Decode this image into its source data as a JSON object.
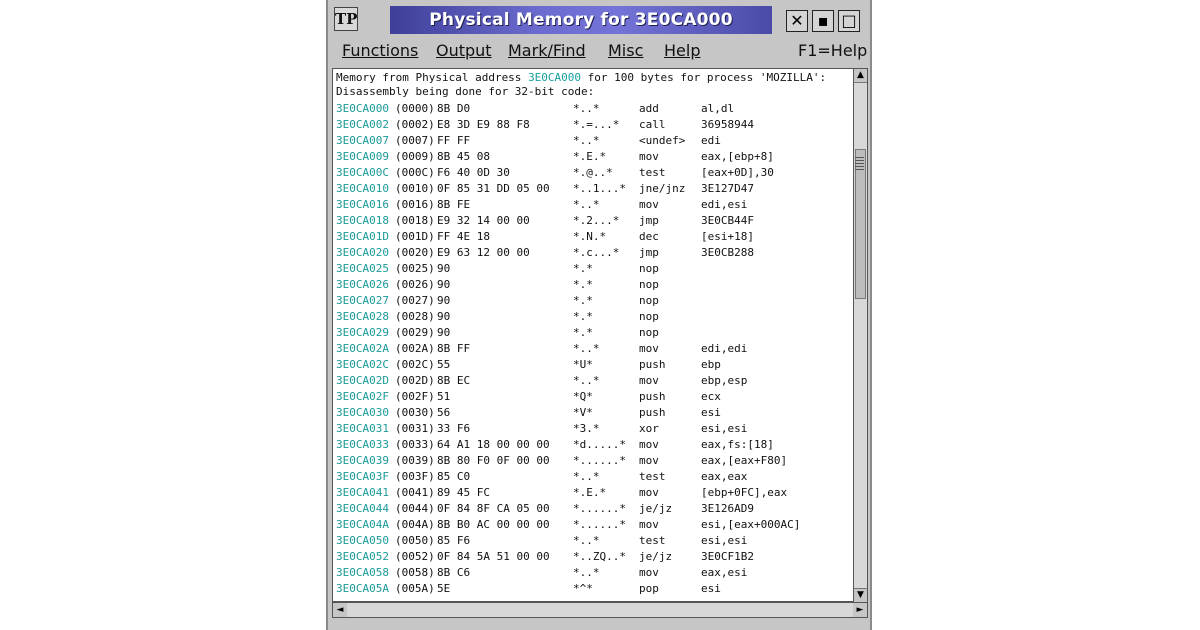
{
  "window": {
    "title": "Physical Memory for 3E0CA000",
    "sys_menu_glyph": "TP",
    "close_glyph": "✕",
    "min_glyph": "▪",
    "max_glyph": "□"
  },
  "menu": {
    "items": [
      "Functions",
      "Output",
      "Mark/Find",
      "Misc",
      "Help"
    ],
    "help_hint": "F1=Help"
  },
  "header": {
    "line1_pre": "Memory from Physical address ",
    "line1_addr": "3E0CA000",
    "line1_post": " for 100 bytes for process 'MOZILLA':",
    "line2": "Disassembly being done for 32-bit code:"
  },
  "rows": [
    {
      "addr": "3E0CA000",
      "off": "(0000)",
      "hex": "8B D0",
      "asc": "*..*",
      "mn": "add",
      "op": "al,dl"
    },
    {
      "addr": "3E0CA002",
      "off": "(0002)",
      "hex": "E8 3D E9 88 F8",
      "asc": "*.=...*",
      "mn": "call",
      "op": "36958944"
    },
    {
      "addr": "3E0CA007",
      "off": "(0007)",
      "hex": "FF FF",
      "asc": "*..*",
      "mn": "<undef>",
      "op": "edi"
    },
    {
      "addr": "3E0CA009",
      "off": "(0009)",
      "hex": "8B 45 08",
      "asc": "*.E.*",
      "mn": "mov",
      "op": "eax,[ebp+8]"
    },
    {
      "addr": "3E0CA00C",
      "off": "(000C)",
      "hex": "F6 40 0D 30",
      "asc": "*.@..*",
      "mn": "test",
      "op": "[eax+0D],30"
    },
    {
      "addr": "3E0CA010",
      "off": "(0010)",
      "hex": "0F 85 31 DD 05 00",
      "asc": "*..1...*",
      "mn": "jne/jnz",
      "op": "3E127D47"
    },
    {
      "addr": "3E0CA016",
      "off": "(0016)",
      "hex": "8B FE",
      "asc": "*..*",
      "mn": "mov",
      "op": "edi,esi"
    },
    {
      "addr": "3E0CA018",
      "off": "(0018)",
      "hex": "E9 32 14 00 00",
      "asc": "*.2...*",
      "mn": "jmp",
      "op": "3E0CB44F"
    },
    {
      "addr": "3E0CA01D",
      "off": "(001D)",
      "hex": "FF 4E 18",
      "asc": "*.N.*",
      "mn": "dec",
      "op": "[esi+18]"
    },
    {
      "addr": "3E0CA020",
      "off": "(0020)",
      "hex": "E9 63 12 00 00",
      "asc": "*.c...*",
      "mn": "jmp",
      "op": "3E0CB288"
    },
    {
      "addr": "3E0CA025",
      "off": "(0025)",
      "hex": "90",
      "asc": "*.*",
      "mn": "nop",
      "op": ""
    },
    {
      "addr": "3E0CA026",
      "off": "(0026)",
      "hex": "90",
      "asc": "*.*",
      "mn": "nop",
      "op": ""
    },
    {
      "addr": "3E0CA027",
      "off": "(0027)",
      "hex": "90",
      "asc": "*.*",
      "mn": "nop",
      "op": ""
    },
    {
      "addr": "3E0CA028",
      "off": "(0028)",
      "hex": "90",
      "asc": "*.*",
      "mn": "nop",
      "op": ""
    },
    {
      "addr": "3E0CA029",
      "off": "(0029)",
      "hex": "90",
      "asc": "*.*",
      "mn": "nop",
      "op": ""
    },
    {
      "addr": "3E0CA02A",
      "off": "(002A)",
      "hex": "8B FF",
      "asc": "*..*",
      "mn": "mov",
      "op": "edi,edi"
    },
    {
      "addr": "3E0CA02C",
      "off": "(002C)",
      "hex": "55",
      "asc": "*U*",
      "mn": "push",
      "op": "ebp"
    },
    {
      "addr": "3E0CA02D",
      "off": "(002D)",
      "hex": "8B EC",
      "asc": "*..*",
      "mn": "mov",
      "op": "ebp,esp"
    },
    {
      "addr": "3E0CA02F",
      "off": "(002F)",
      "hex": "51",
      "asc": "*Q*",
      "mn": "push",
      "op": "ecx"
    },
    {
      "addr": "3E0CA030",
      "off": "(0030)",
      "hex": "56",
      "asc": "*V*",
      "mn": "push",
      "op": "esi"
    },
    {
      "addr": "3E0CA031",
      "off": "(0031)",
      "hex": "33 F6",
      "asc": "*3.*",
      "mn": "xor",
      "op": "esi,esi"
    },
    {
      "addr": "3E0CA033",
      "off": "(0033)",
      "hex": "64 A1 18 00 00 00",
      "asc": "*d.....*",
      "mn": "mov",
      "op": "eax,fs:[18]"
    },
    {
      "addr": "3E0CA039",
      "off": "(0039)",
      "hex": "8B 80 F0 0F 00 00",
      "asc": "*......*",
      "mn": "mov",
      "op": "eax,[eax+F80]"
    },
    {
      "addr": "3E0CA03F",
      "off": "(003F)",
      "hex": "85 C0",
      "asc": "*..*",
      "mn": "test",
      "op": "eax,eax"
    },
    {
      "addr": "3E0CA041",
      "off": "(0041)",
      "hex": "89 45 FC",
      "asc": "*.E.*",
      "mn": "mov",
      "op": "[ebp+0FC],eax"
    },
    {
      "addr": "3E0CA044",
      "off": "(0044)",
      "hex": "0F 84 8F CA 05 00",
      "asc": "*......*",
      "mn": "je/jz",
      "op": "3E126AD9"
    },
    {
      "addr": "3E0CA04A",
      "off": "(004A)",
      "hex": "8B B0 AC 00 00 00",
      "asc": "*......*",
      "mn": "mov",
      "op": "esi,[eax+000AC]"
    },
    {
      "addr": "3E0CA050",
      "off": "(0050)",
      "hex": "85 F6",
      "asc": "*..*",
      "mn": "test",
      "op": "esi,esi"
    },
    {
      "addr": "3E0CA052",
      "off": "(0052)",
      "hex": "0F 84 5A 51 00 00",
      "asc": "*..ZQ..*",
      "mn": "je/jz",
      "op": "3E0CF1B2"
    },
    {
      "addr": "3E0CA058",
      "off": "(0058)",
      "hex": "8B C6",
      "asc": "*..*",
      "mn": "mov",
      "op": "eax,esi"
    },
    {
      "addr": "3E0CA05A",
      "off": "(005A)",
      "hex": "5E",
      "asc": "*^*",
      "mn": "pop",
      "op": "esi"
    }
  ],
  "scroll": {
    "up": "▲",
    "down": "▼",
    "left": "◄",
    "right": "►"
  }
}
